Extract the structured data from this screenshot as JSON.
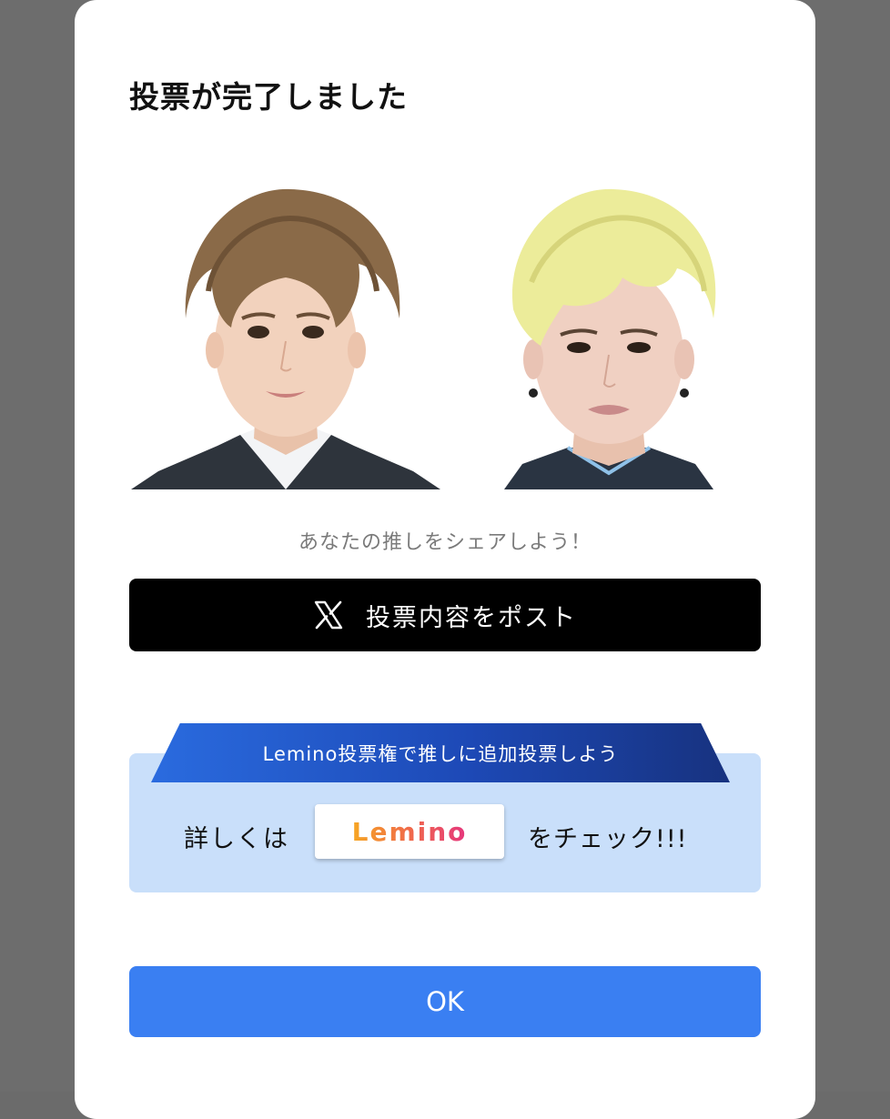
{
  "modal": {
    "title": "投票が完了しました",
    "share_caption": "あなたの推しをシェアしよう！",
    "post_button": {
      "icon": "x-logo-icon",
      "label": "投票内容をポスト"
    },
    "promo": {
      "ribbon_text": "Lemino投票権で推しに追加投票しよう",
      "prefix": "詳しくは",
      "logo_text": "Lemino",
      "suffix": "をチェック!!!"
    },
    "ok_button": {
      "label": "OK"
    }
  },
  "colors": {
    "backdrop": "#6d6d6d",
    "post_button": "#000000",
    "promo_background": "#c9dffa",
    "ribbon_start": "#2a6bdf",
    "ribbon_end": "#17327f",
    "ok_button": "#3a7ff2"
  }
}
